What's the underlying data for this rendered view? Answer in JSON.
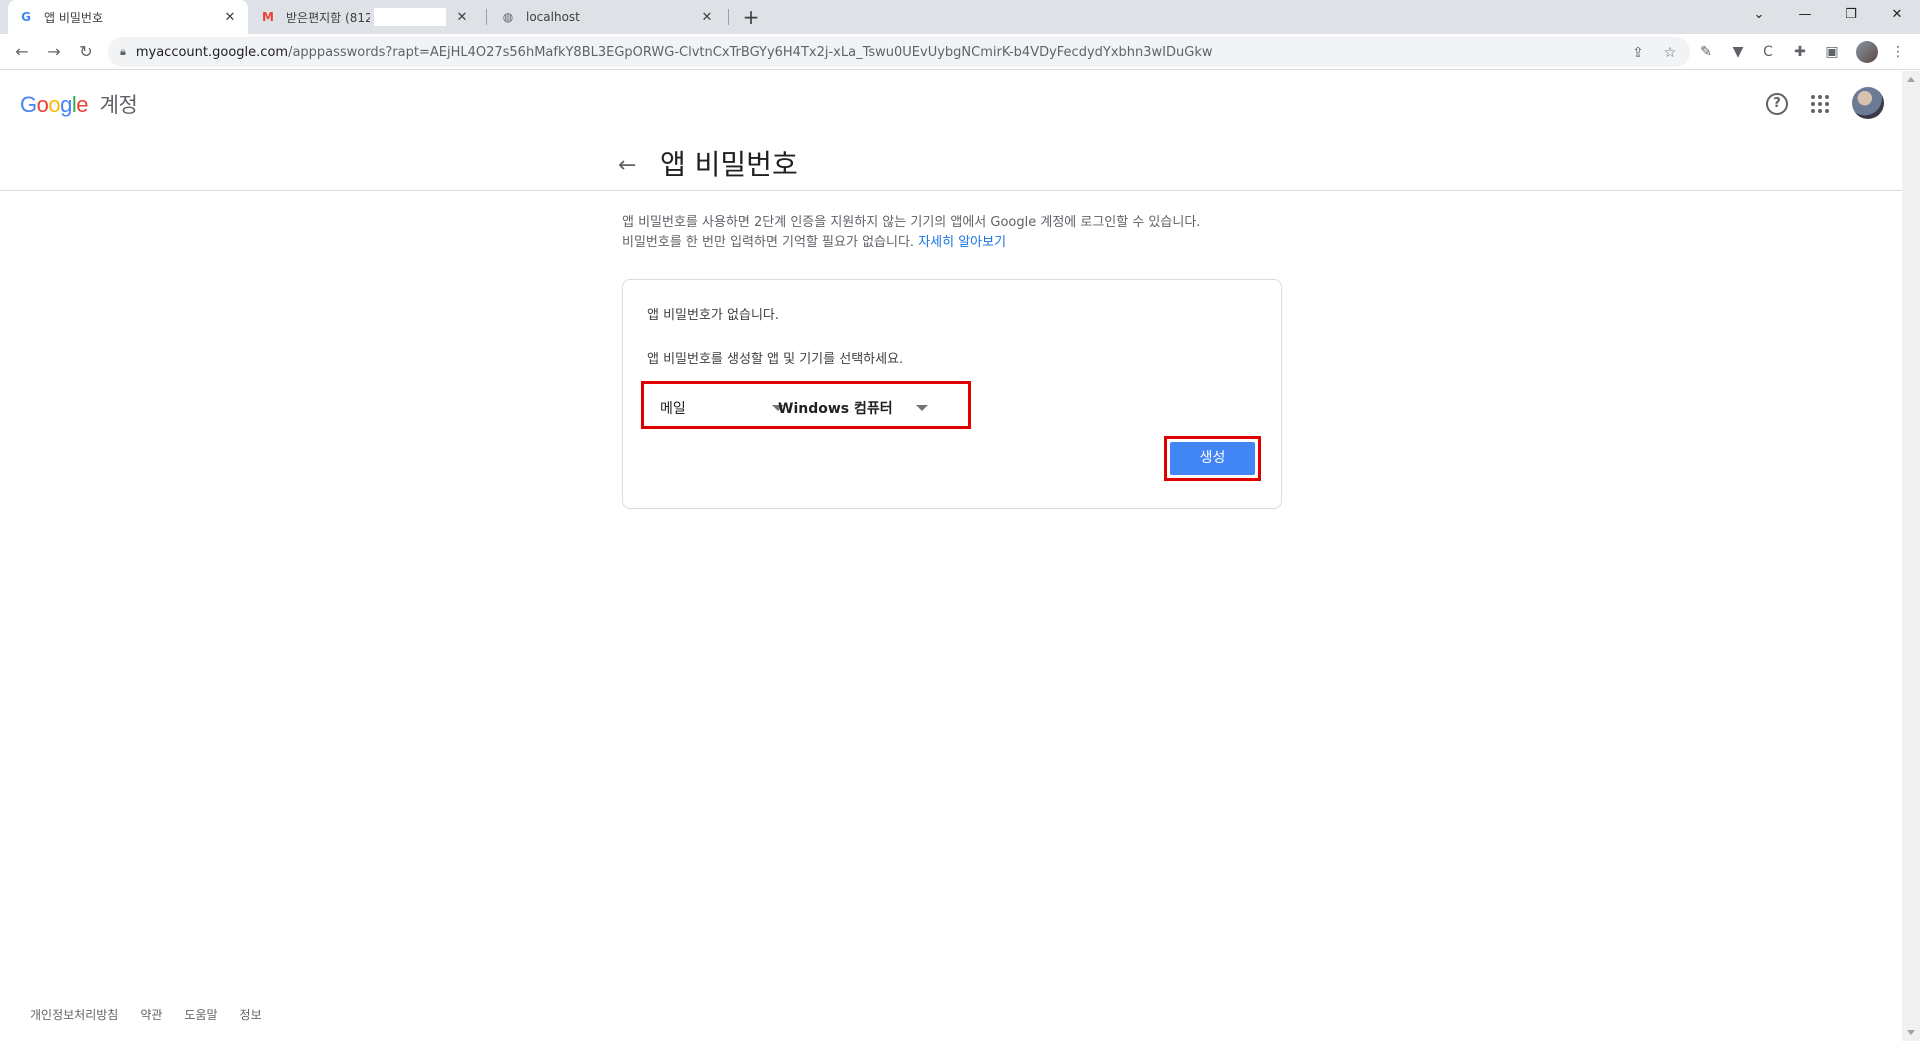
{
  "browser": {
    "tabs": [
      {
        "label": "앱 비밀번호",
        "favicon": "G"
      },
      {
        "label": "받은편지함 (812) -",
        "favicon": "M"
      },
      {
        "label": "localhost",
        "favicon": "globe-icon"
      }
    ],
    "url_host": "myaccount.google.com",
    "url_path": "/apppasswords?rapt=AEjHL4O27s56hMafkY8BL3EGpORWG-ClvtnCxTrBGYy6H4Tx2j-xLa_Tswu0UEvUybgNCmirK-b4VDyFecdydYxbhn3wIDuGkw"
  },
  "header": {
    "logo_letters": [
      "G",
      "o",
      "o",
      "g",
      "l",
      "e"
    ],
    "account_label": "계정"
  },
  "page": {
    "title": "앱 비밀번호",
    "description_line1": "앱 비밀번호를 사용하면 2단계 인증을 지원하지 않는 기기의 앱에서 Google 계정에 로그인할 수 있습니다.",
    "description_line2": "비밀번호를 한 번만 입력하면 기억할 필요가 없습니다.",
    "learn_more": "자세히 알아보기"
  },
  "card": {
    "no_passwords": "앱 비밀번호가 없습니다.",
    "instruction": "앱 비밀번호를 생성할 앱 및 기기를 선택하세요.",
    "app_select": "메일",
    "device_select": "Windows 컴퓨터",
    "generate_label": "생성"
  },
  "footer": {
    "links": [
      "개인정보처리방침",
      "약관",
      "도움말",
      "정보"
    ]
  },
  "colors": {
    "accent": "#4285f4",
    "highlight": "#e00000",
    "link": "#1a73e8"
  }
}
